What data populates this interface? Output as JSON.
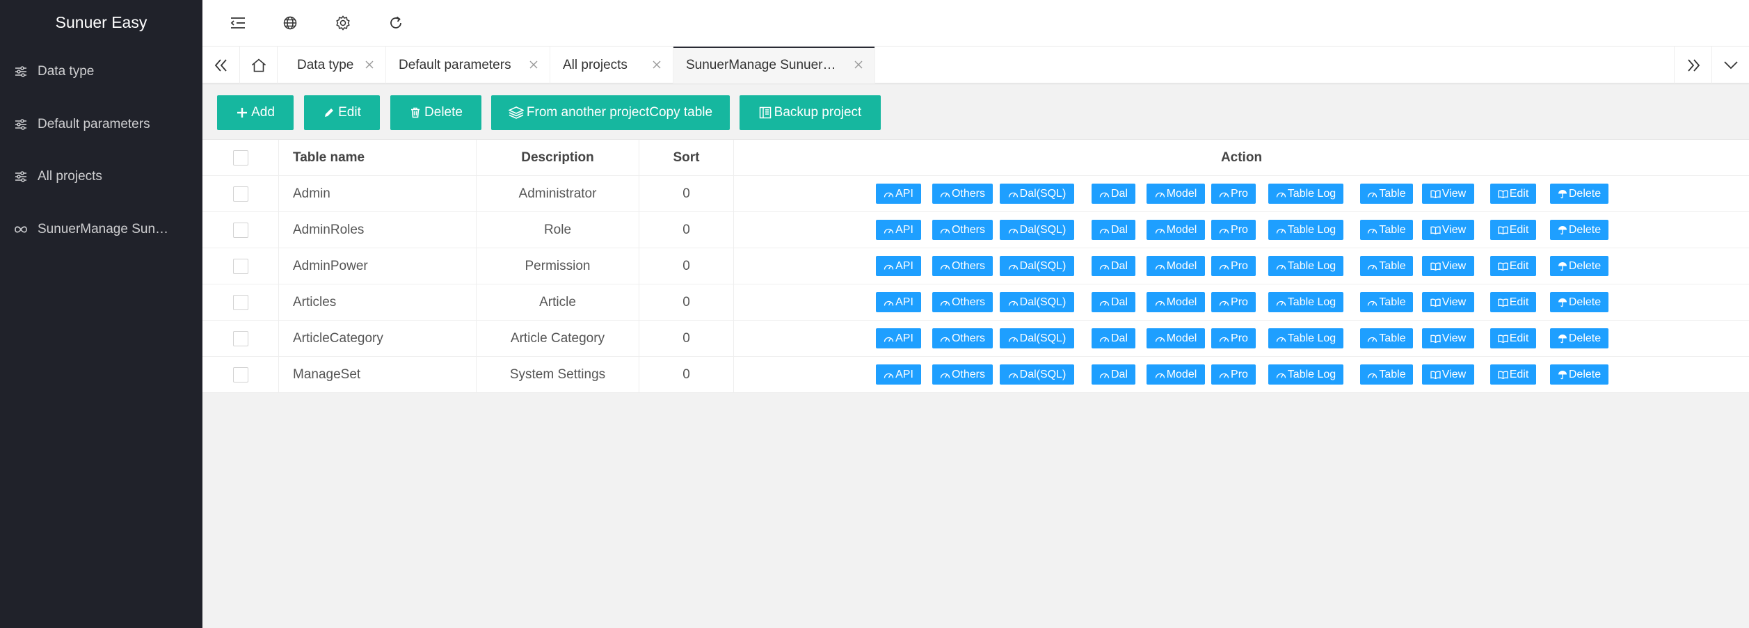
{
  "app": {
    "title": "Sunuer Easy"
  },
  "sidebar": {
    "items": [
      {
        "label": "Data type",
        "icon": "sliders-icon"
      },
      {
        "label": "Default parameters",
        "icon": "sliders-icon"
      },
      {
        "label": "All projects",
        "icon": "sliders-icon"
      },
      {
        "label": "SunuerManage Sun…",
        "icon": "infinity-icon"
      }
    ]
  },
  "header": {
    "icons": [
      "menu-fold-icon",
      "globe-icon",
      "gear-icon",
      "refresh-icon"
    ]
  },
  "tabs": {
    "items": [
      {
        "label": "Data type"
      },
      {
        "label": "Default parameters"
      },
      {
        "label": "All projects"
      },
      {
        "label": "SunuerManage Sunuer…"
      }
    ],
    "close_glyph": "×",
    "active_index": 3
  },
  "toolbar": {
    "add_label": "Add",
    "edit_label": "Edit",
    "delete_label": "Delete",
    "copy_label": "From another projectCopy table",
    "backup_label": "Backup project"
  },
  "table": {
    "headers": {
      "name": "Table name",
      "description": "Description",
      "sort": "Sort",
      "action": "Action"
    },
    "rows": [
      {
        "name": "Admin",
        "description": "Administrator",
        "sort": "0"
      },
      {
        "name": "AdminRoles",
        "description": "Role",
        "sort": "0"
      },
      {
        "name": "AdminPower",
        "description": "Permission",
        "sort": "0"
      },
      {
        "name": "Articles",
        "description": "Article",
        "sort": "0"
      },
      {
        "name": "ArticleCategory",
        "description": "Article Category",
        "sort": "0"
      },
      {
        "name": "ManageSet",
        "description": "System Settings",
        "sort": "0"
      }
    ],
    "actions": [
      "API",
      "Others",
      "Dal(SQL)",
      "Dal",
      "Model",
      "Pro",
      "Table Log",
      "Table",
      "View",
      "Edit",
      "Delete"
    ]
  },
  "colors": {
    "sidebar_bg": "#20222a",
    "toolbar_button": "#16b79f",
    "action_button": "#1e9fff",
    "page_bg": "#f2f2f2"
  }
}
